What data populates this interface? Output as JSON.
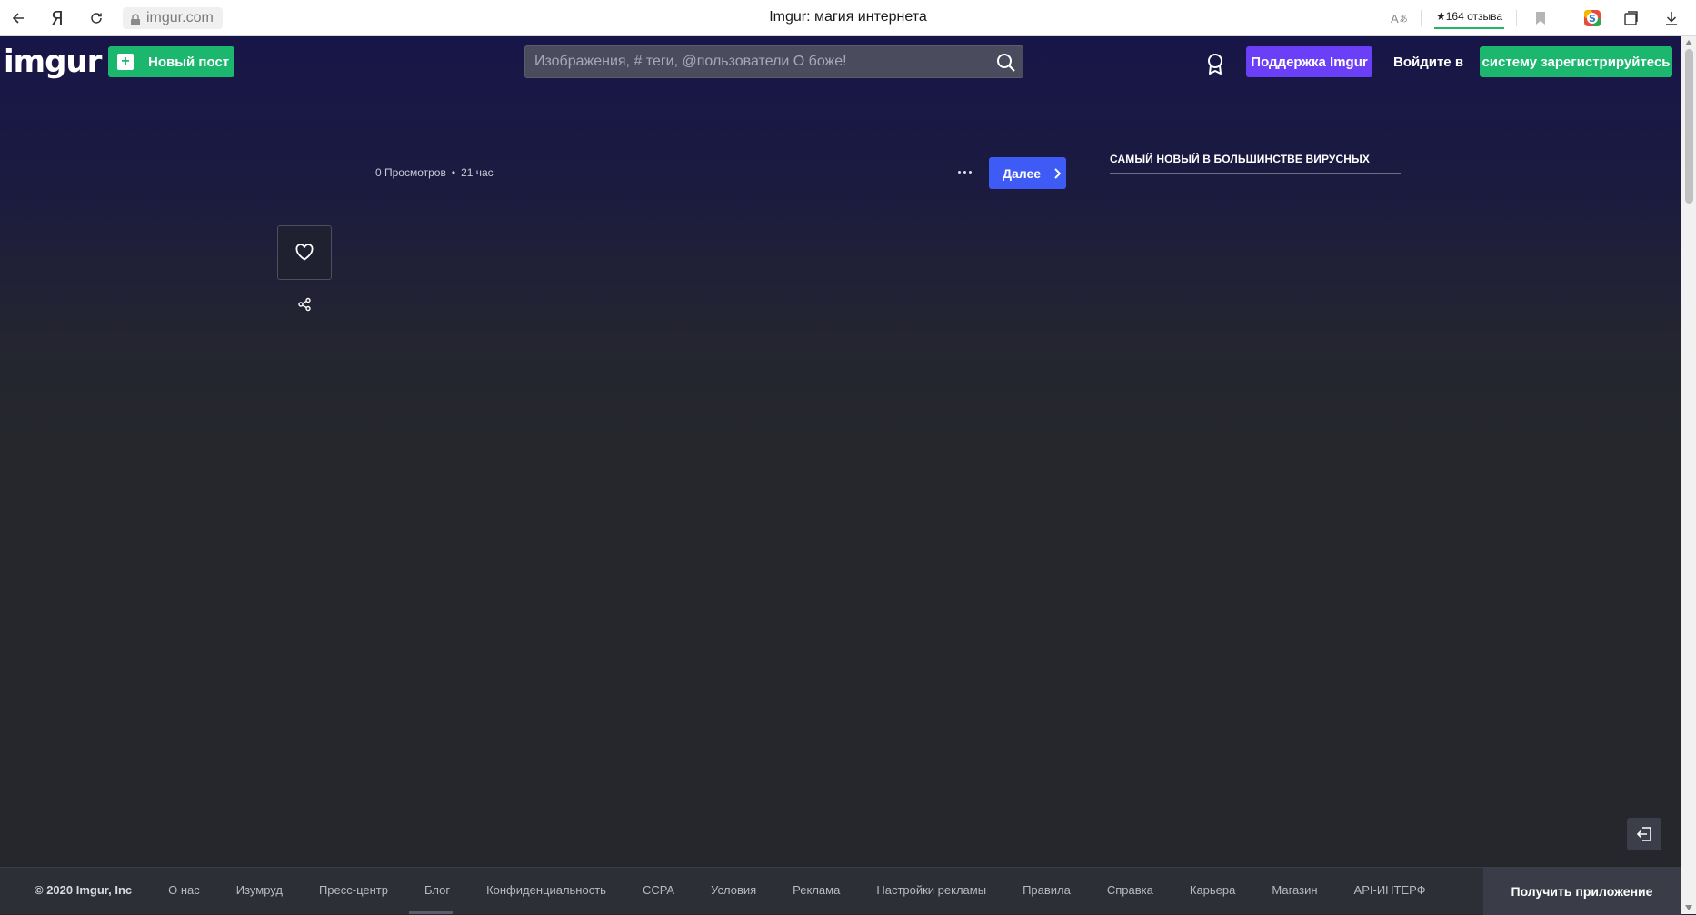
{
  "browser": {
    "address": "imgur.com",
    "tab_title": "Imgur: магия интернета",
    "yandex_letter": "Я",
    "reviews": "★164 отзыва",
    "translate_label": "A"
  },
  "header": {
    "logo": "imgur",
    "new_post_label": "Новый пост",
    "search_placeholder": "Изображения, # теги, @пользователи О боже!",
    "support_label": "Поддержка Imgur",
    "login_label": "Войдите в",
    "register_label": "систему зарегистрируйтесь"
  },
  "post": {
    "views": "0 Просмотров",
    "separator": "•",
    "time": "21 час",
    "next_label": "Далее"
  },
  "sidebar": {
    "title": "САМЫЙ НОВЫЙ В БОЛЬШИНСТВЕ ВИРУСНЫХ"
  },
  "footer": {
    "copyright": "© 2020 Imgur, Inc",
    "links": [
      "О нас",
      "Изумруд",
      "Пресс-центр",
      "Блог",
      "Конфиденциальность",
      "CCPA",
      "Условия",
      "Реклама",
      "Настройки рекламы",
      "Правила",
      "Справка",
      "Карьера",
      "Магазин",
      "API-ИНТЕРФ"
    ],
    "get_app_label": "Получить приложение"
  },
  "colors": {
    "accent_green": "#1bb76e",
    "support_purple": "#6a3ff7",
    "next_blue": "#3e5bf5"
  }
}
